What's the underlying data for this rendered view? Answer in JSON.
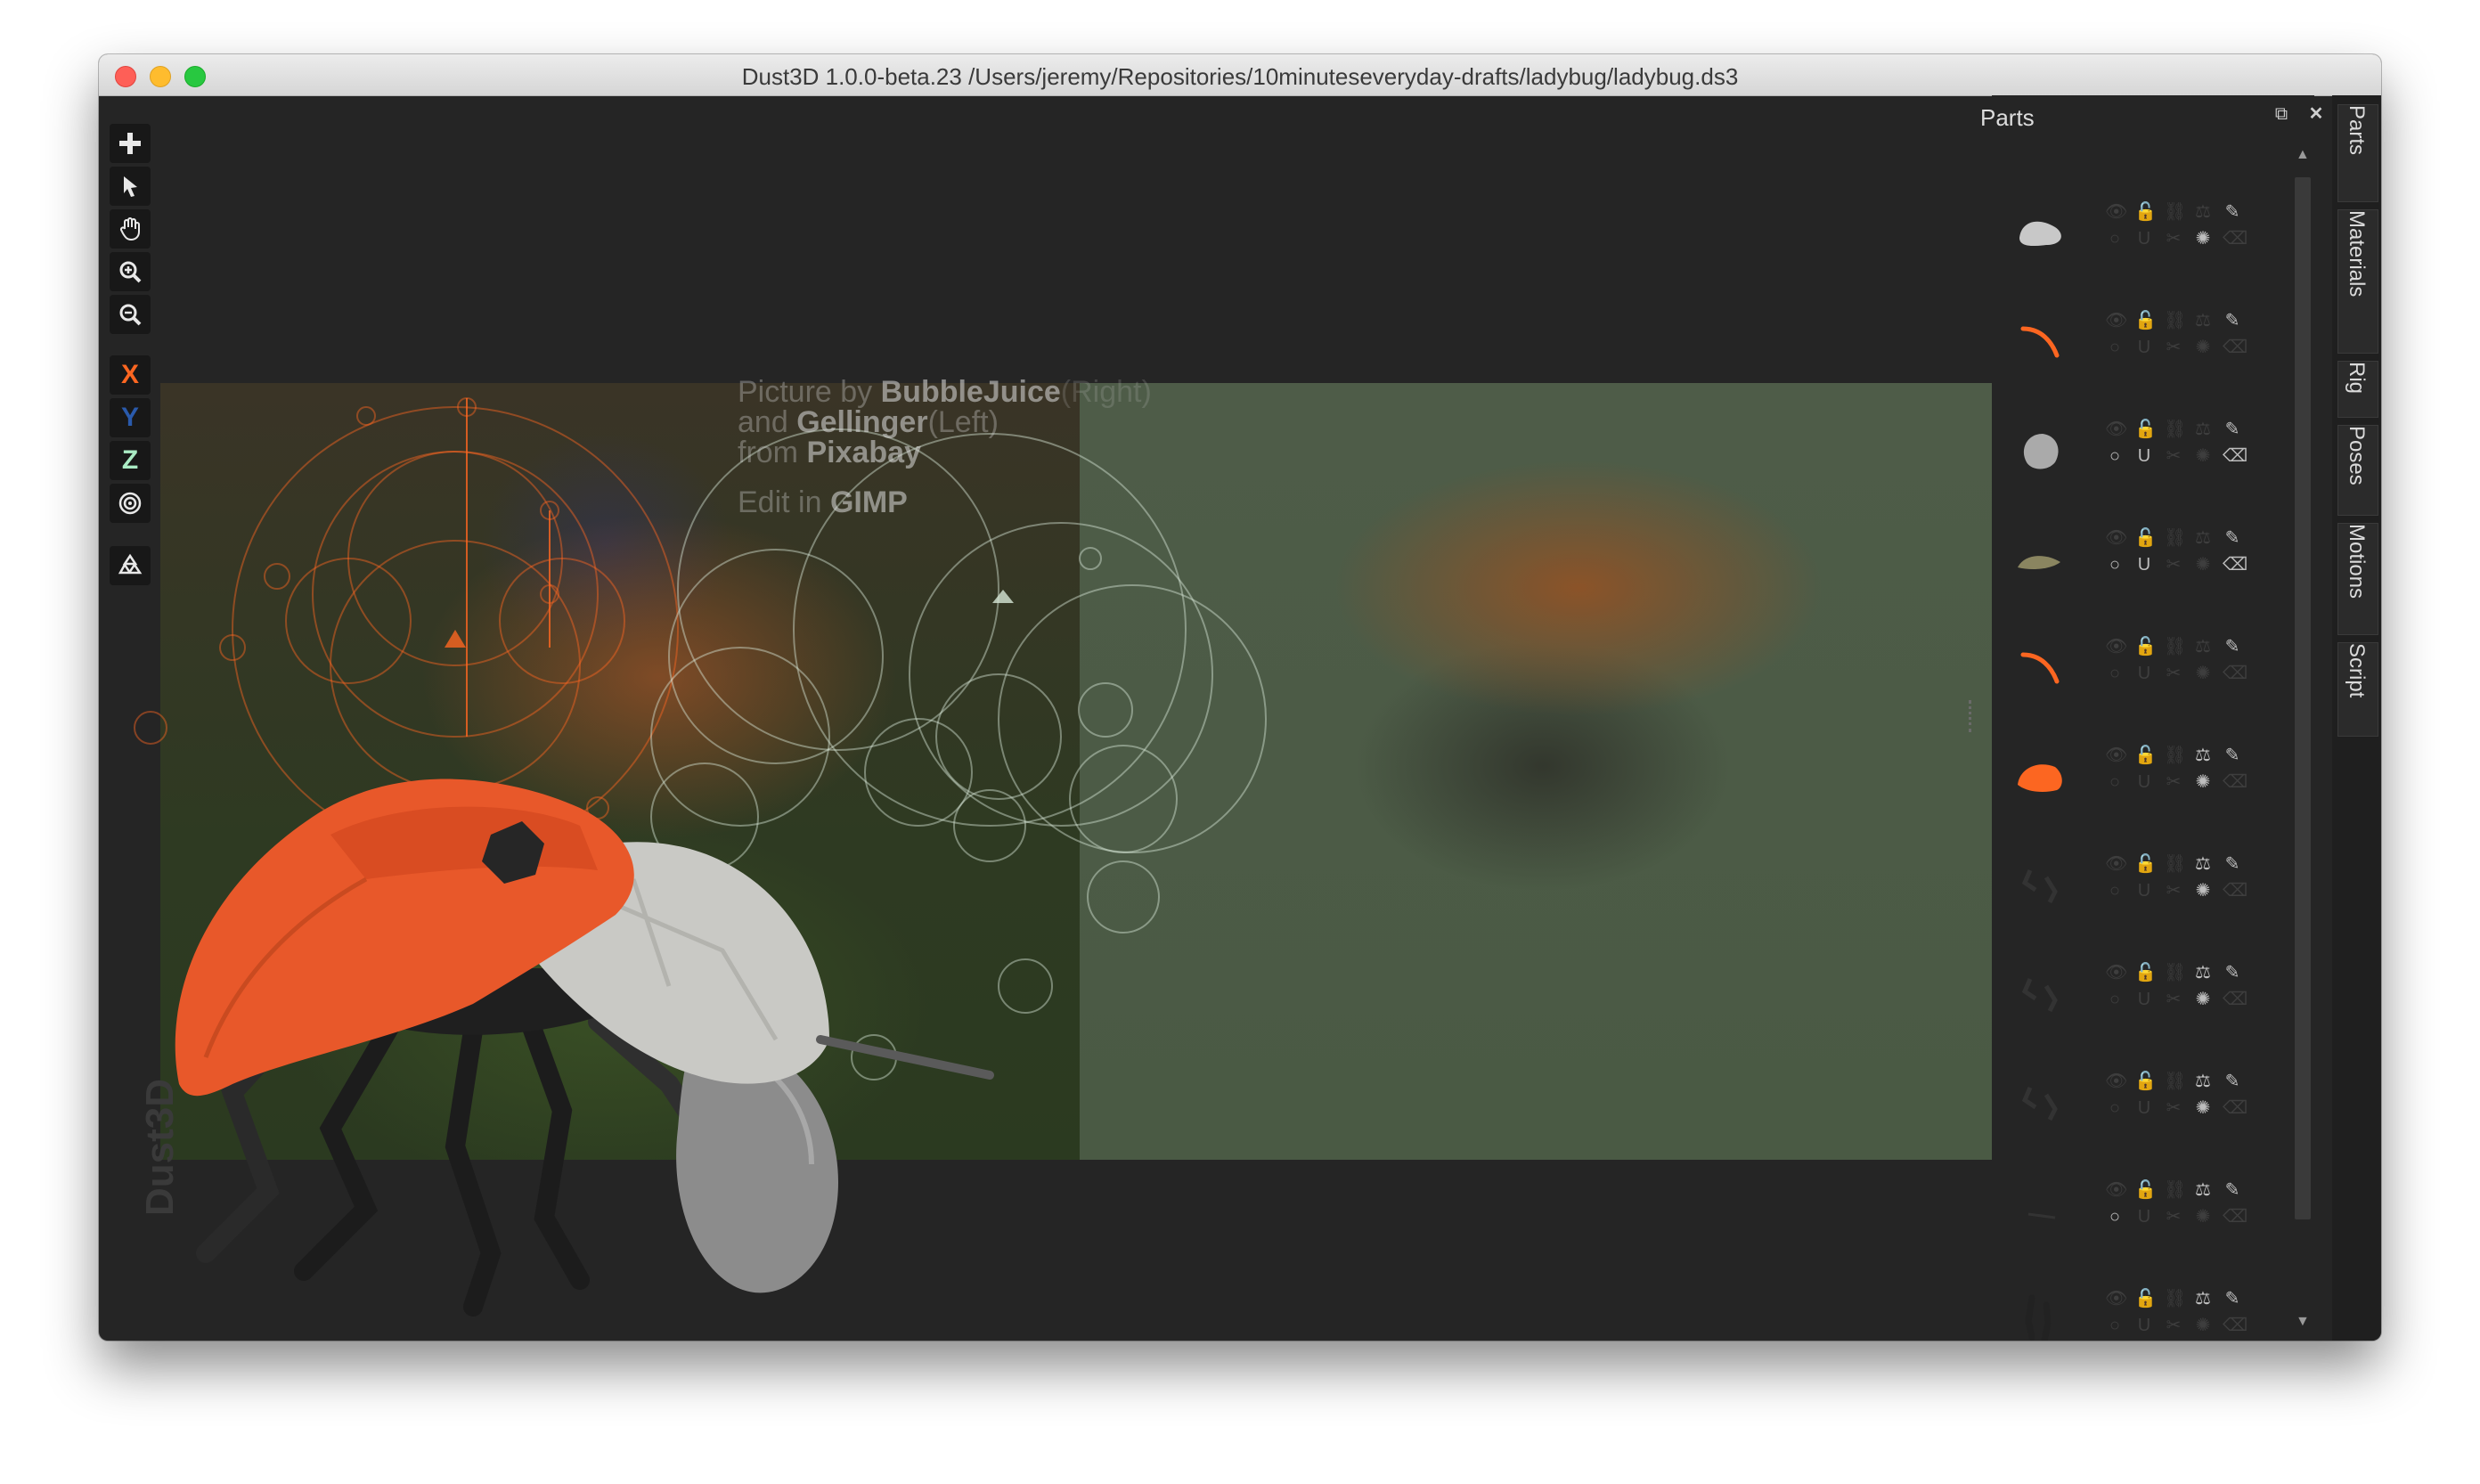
{
  "window": {
    "title": "Dust3D 1.0.0-beta.23 /Users/jeremy/Repositories/10minuteseveryday-drafts/ladybug/ladybug.ds3"
  },
  "toolbar": {
    "tools": [
      {
        "name": "add-icon",
        "glyph": "+"
      },
      {
        "name": "select-cursor-icon",
        "glyph": "➤"
      },
      {
        "name": "hand-pan-icon",
        "glyph": "✋"
      },
      {
        "name": "zoom-in-icon",
        "glyph": "⊕"
      },
      {
        "name": "zoom-out-icon",
        "glyph": "⊖"
      }
    ],
    "axes": {
      "x": "X",
      "y": "Y",
      "z": "Z"
    },
    "axis_colors": {
      "x": "#fc6621",
      "y": "#2a5aac",
      "z": "#aaebc4"
    }
  },
  "reference": {
    "credit_line1_pre": "Picture by ",
    "credit_line1_bold": "BubbleJuice",
    "credit_line1_post": "(Right)",
    "credit_line2_pre": "and ",
    "credit_line2_bold": "Gellinger",
    "credit_line2_post": "(Left)",
    "credit_line3_pre": "from ",
    "credit_line3_bold": "Pixabay",
    "credit_line4_pre": "Edit in ",
    "credit_line4_bold": "GIMP"
  },
  "watermark": "Dust3D",
  "parts": {
    "title": "Parts",
    "items": [
      {
        "shape": "pebble",
        "color": "#c8c8c8",
        "rows": [
          "eye",
          "lock",
          "link",
          "balance",
          "brush"
        ],
        "disabled": false
      },
      {
        "shape": "curve",
        "color": "#fc6621",
        "disabled": false
      },
      {
        "shape": "blob",
        "color": "#aaaaaa",
        "disabled": false
      },
      {
        "shape": "flat",
        "color": "#8a8560",
        "disabled": false
      },
      {
        "shape": "curve",
        "color": "#fc6621",
        "disabled": false
      },
      {
        "shape": "shell",
        "color": "#fc6621",
        "disabled": false
      },
      {
        "shape": "legs",
        "color": "#333333",
        "disabled": false
      },
      {
        "shape": "legs",
        "color": "#333333",
        "disabled": false
      },
      {
        "shape": "legs",
        "color": "#333333",
        "disabled": false
      },
      {
        "shape": "thin",
        "color": "#333333",
        "disabled": false
      },
      {
        "shape": "legs2",
        "color": "#222222",
        "disabled": false
      },
      {
        "shape": "antenna",
        "color": "#1a1a1a",
        "disabled": false
      }
    ]
  },
  "side_tabs": [
    "Parts",
    "Materials",
    "Rig",
    "Poses",
    "Motions",
    "Script"
  ],
  "colors": {
    "accent": "#fc6621",
    "background": "#252525"
  }
}
